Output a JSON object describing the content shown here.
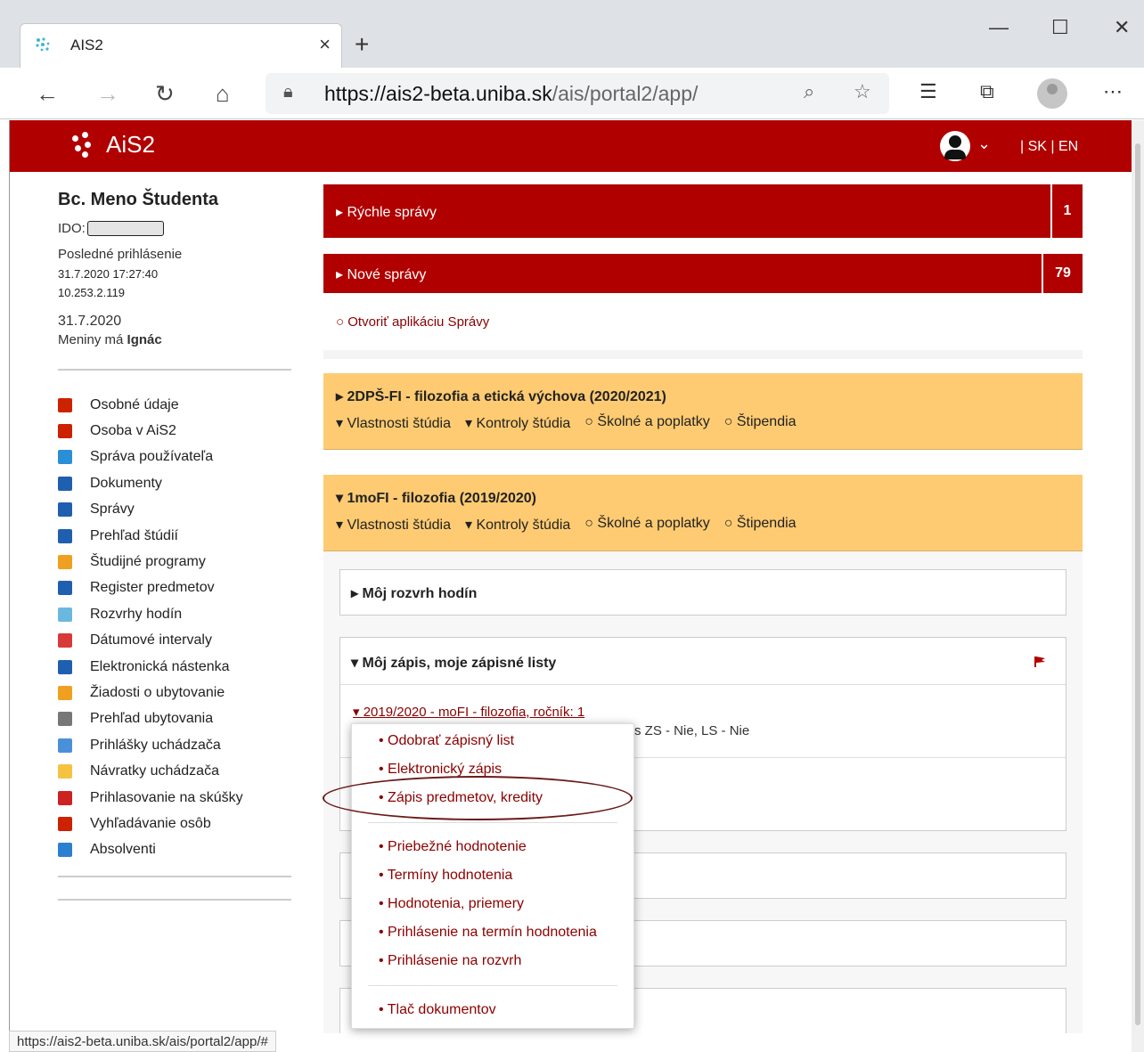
{
  "browser": {
    "tab_title": "AIS2",
    "tab_close": "×",
    "new_tab": "+",
    "url_domain": "https://ais2-beta.uniba.sk",
    "url_path": "/ais/portal2/app/",
    "status_url": "https://ais2-beta.uniba.sk/ais/portal2/app/#"
  },
  "header": {
    "logo_text": "AiS2",
    "lang": "| SK | EN"
  },
  "sidebar": {
    "student_name": "Bc. Meno Študenta",
    "ido_label": "IDO:",
    "last_login_label": "Posledné prihlásenie",
    "last_login_time": "31.7.2020 17:27:40",
    "last_login_ip": "10.253.2.119",
    "today": "31.7.2020",
    "meniny_prefix": "Meniny má ",
    "meniny_name": "Ignác",
    "items": [
      {
        "label": "Osobné údaje",
        "icon": "person-icon",
        "color": "#cc2200"
      },
      {
        "label": "Osoba v AiS2",
        "icon": "person-icon",
        "color": "#cc2200"
      },
      {
        "label": "Správa používateľa",
        "icon": "org-chart-icon",
        "color": "#2a8fd6"
      },
      {
        "label": "Dokumenty",
        "icon": "document-icon",
        "color": "#1f5fb0"
      },
      {
        "label": "Správy",
        "icon": "message-icon",
        "color": "#1f5fb0"
      },
      {
        "label": "Prehľad štúdií",
        "icon": "studies-icon",
        "color": "#1f5fb0"
      },
      {
        "label": "Študijné programy",
        "icon": "list-icon",
        "color": "#f0a020"
      },
      {
        "label": "Register predmetov",
        "icon": "briefcase-icon",
        "color": "#1f5fb0"
      },
      {
        "label": "Rozvrhy hodín",
        "icon": "calendar-icon",
        "color": "#6ab8e0"
      },
      {
        "label": "Dátumové intervaly",
        "icon": "calendar-icon",
        "color": "#d83a3a"
      },
      {
        "label": "Elektronická nástenka",
        "icon": "e-board-icon",
        "color": "#1f5fb0"
      },
      {
        "label": "Žiadosti o ubytovanie",
        "icon": "accommodation-icon",
        "color": "#f0a020"
      },
      {
        "label": "Prehľad ubytovania",
        "icon": "grid-icon",
        "color": "#777777"
      },
      {
        "label": "Prihlášky uchádzača",
        "icon": "checkbox-icon",
        "color": "#4a90d9"
      },
      {
        "label": "Návratky uchádzača",
        "icon": "return-icon",
        "color": "#f5c242"
      },
      {
        "label": "Prihlasovanie na skúšky",
        "icon": "exam-icon",
        "color": "#cc2222"
      },
      {
        "label": "Vyhľadávanie osôb",
        "icon": "person-search-icon",
        "color": "#cc2200"
      },
      {
        "label": "Absolventi",
        "icon": "graduate-icon",
        "color": "#2a7fd0"
      }
    ]
  },
  "main": {
    "quick_messages": {
      "label": "Rýchle správy",
      "count": "1"
    },
    "new_messages": {
      "label": "Nové správy",
      "count": "79"
    },
    "open_messages_link": "○ Otvoriť aplikáciu Správy",
    "study1": {
      "title": "2DPŠ-FI - filozofia a etická výchova (2020/2021)",
      "actions": [
        "▾ Vlastnosti štúdia",
        "▾ Kontroly štúdia",
        "○ Školné a poplatky",
        "○ Štipendia"
      ]
    },
    "study2": {
      "title": "1moFI - filozofia (2019/2020)",
      "actions": [
        "▾ Vlastnosti štúdia",
        "▾ Kontroly štúdia",
        "○ Školné a poplatky",
        "○ Štipendia"
      ]
    },
    "schedule_panel": "Môj rozvrh hodín",
    "enrollment_panel": "Môj zápis, moje zápisné listy",
    "enrollment_link": "2019/2020 - moFI - filozofia, ročník: 1",
    "enrollment_info": "ápis ZS - Nie, LS - Nie"
  },
  "dropdown": {
    "group1": [
      "• Odobrať zápisný list",
      "• Elektronický zápis",
      "• Zápis predmetov, kredity"
    ],
    "group2": [
      "• Priebežné hodnotenie",
      "• Termíny hodnotenia",
      "• Hodnotenia, priemery",
      "• Prihlásenie na termín hodnotenia",
      "• Prihlásenie na rozvrh"
    ],
    "group3": [
      "• Tlač dokumentov"
    ]
  }
}
